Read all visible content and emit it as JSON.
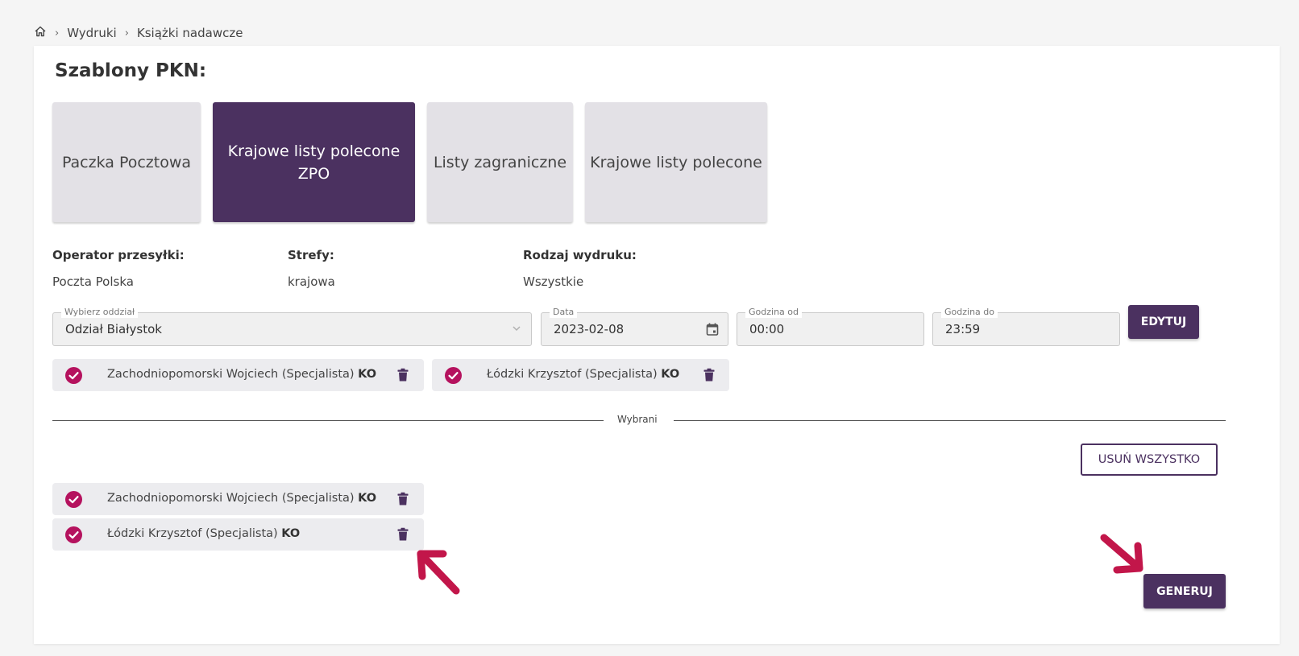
{
  "breadcrumb": {
    "home_icon": "home-icon",
    "items": [
      "Wydruki",
      "Książki nadawcze"
    ]
  },
  "page": {
    "title": "Szablony PKN:"
  },
  "templates": [
    {
      "line1": "Paczka Pocztowa",
      "line2": ""
    },
    {
      "line1": "Krajowe listy polecone",
      "line2": "ZPO"
    },
    {
      "line1": "Listy zagraniczne",
      "line2": ""
    },
    {
      "line1": "Krajowe listy polecone",
      "line2": ""
    }
  ],
  "info": {
    "operator_label": "Operator przesyłki:",
    "operator_value": "Poczta Polska",
    "zones_label": "Strefy:",
    "zones_value": "krajowa",
    "print_type_label": "Rodzaj wydruku:",
    "print_type_value": "Wszystkie"
  },
  "filters": {
    "branch_label": "Wybierz oddział",
    "branch_value": "Odział Białystok",
    "date_label": "Data",
    "date_value": "2023-02-08",
    "time_from_label": "Godzina od",
    "time_from_value": "00:00",
    "time_to_label": "Godzina do",
    "time_to_value": "23:59",
    "edit_button": "EDYTUJ"
  },
  "available": [
    {
      "name": "Zachodniopomorski Wojciech (Specjalista)",
      "unit": "KO"
    },
    {
      "name": "Łódzki Krzysztof (Specjalista)",
      "unit": "KO"
    }
  ],
  "divider_label": "Wybrani",
  "remove_all_button": "USUŃ WSZYSTKO",
  "selected": [
    {
      "name": "Zachodniopomorski Wojciech (Specjalista)",
      "unit": "KO"
    },
    {
      "name": "Łódzki Krzysztof (Specjalista)",
      "unit": "KO"
    }
  ],
  "generate_button": "GENERUJ",
  "colors": {
    "primary": "#4b3160",
    "check": "#b5125e",
    "arrow": "#c2164a",
    "tile": "#e3e1e6"
  }
}
